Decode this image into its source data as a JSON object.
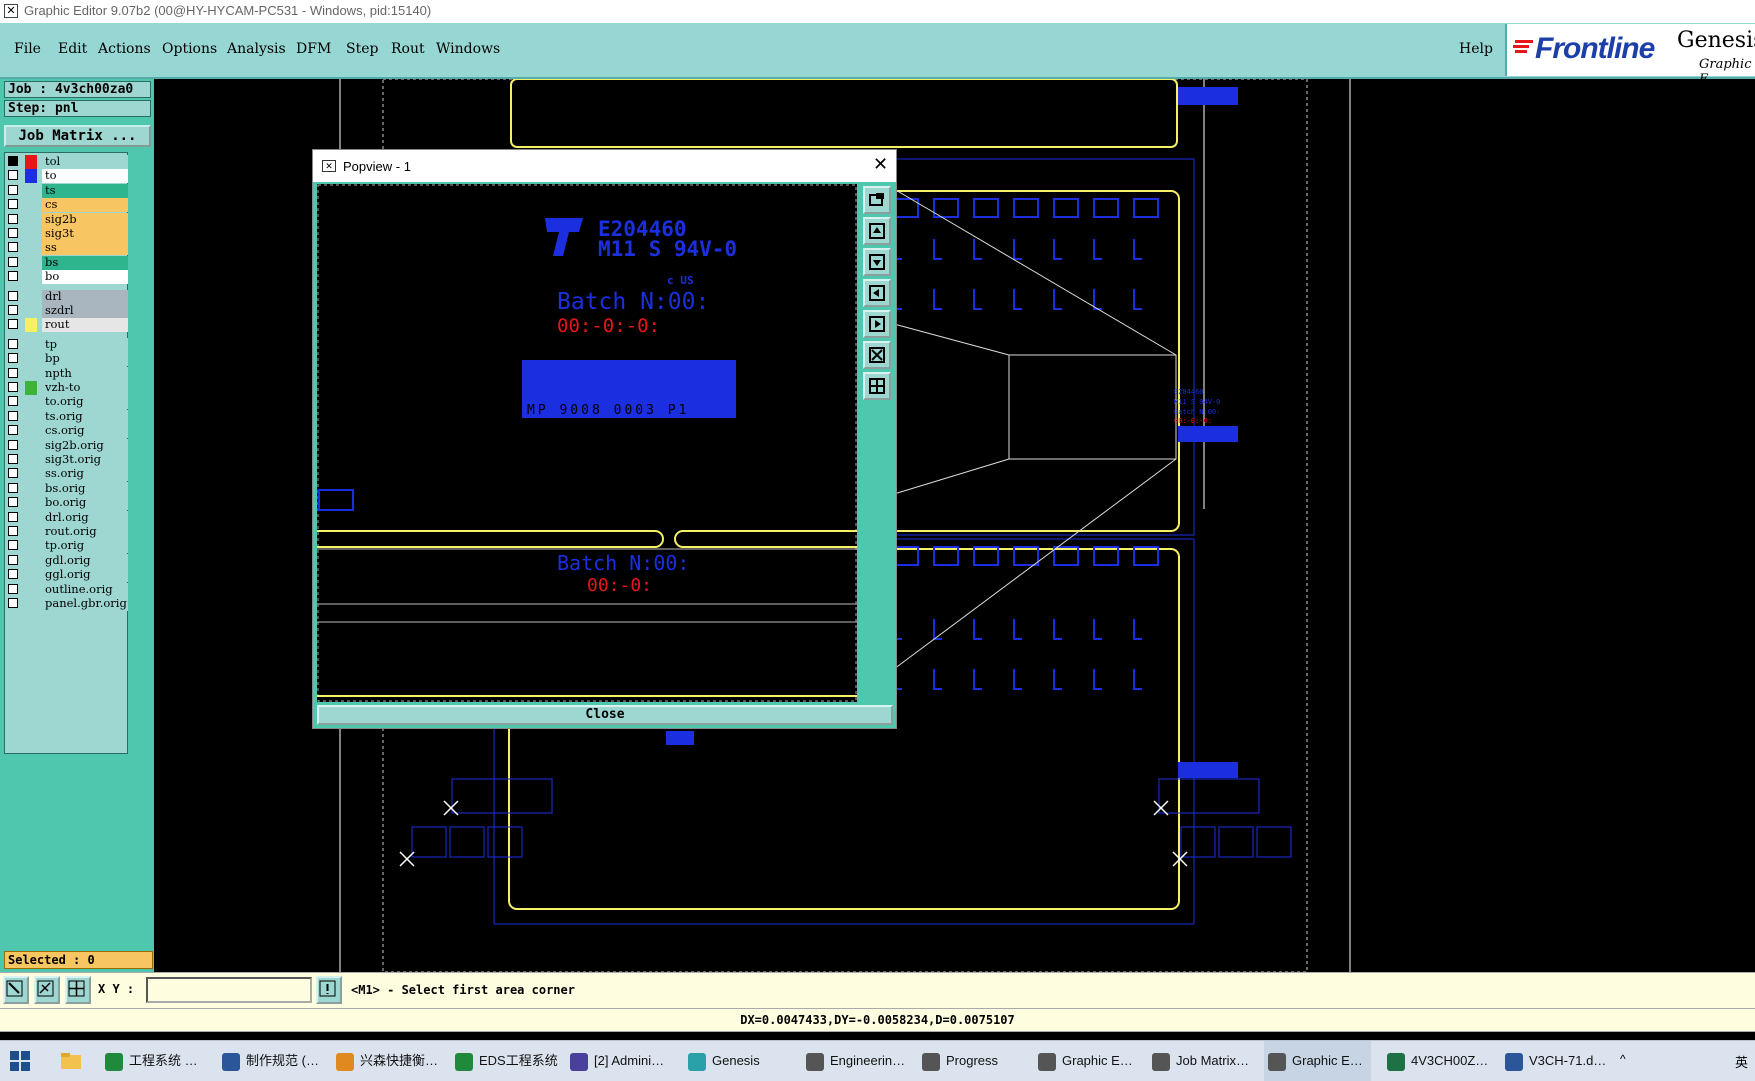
{
  "window": {
    "title": "Graphic Editor 9.07b2 (00@HY-HYCAM-PC531 - Windows, pid:15140)"
  },
  "menu": {
    "items": [
      "File",
      "Edit",
      "Actions",
      "Options",
      "Analysis",
      "DFM",
      "Step",
      "Rout",
      "Windows"
    ],
    "help": "Help"
  },
  "brand": {
    "logo": "Frontline",
    "product": "Genesis",
    "sub": "Graphic E"
  },
  "job": {
    "job_label": "Job : 4v3ch00za0",
    "step_label": "Step: pnl",
    "matrix_button": "Job Matrix ..."
  },
  "layers": [
    {
      "name": "tol",
      "color": "#9ed6d1",
      "swatch": "#e8151b",
      "sel": true
    },
    {
      "name": "to",
      "color": "#ffffff",
      "swatch": "#1b2fe0"
    },
    {
      "name": "ts",
      "color": "#2fb58e",
      "swatch": ""
    },
    {
      "name": "cs",
      "color": "#f7c561",
      "swatch": ""
    },
    {
      "name": "sig2b",
      "color": "#f7c561",
      "swatch": ""
    },
    {
      "name": "sig3t",
      "color": "#f7c561",
      "swatch": ""
    },
    {
      "name": "ss",
      "color": "#f7c561",
      "swatch": ""
    },
    {
      "name": "bs",
      "color": "#2fb58e",
      "swatch": ""
    },
    {
      "name": "bo",
      "color": "#ffffff",
      "swatch": ""
    },
    {
      "name": "drl",
      "color": "#a9b6c0",
      "swatch": "",
      "gap": true
    },
    {
      "name": "szdrl",
      "color": "#a9b6c0",
      "swatch": ""
    },
    {
      "name": "rout",
      "color": "#e6e6e6",
      "swatch": "#f5f066"
    },
    {
      "name": "tp",
      "color": "#9ed6d1",
      "swatch": "",
      "gap": true
    },
    {
      "name": "bp",
      "color": "#9ed6d1",
      "swatch": ""
    },
    {
      "name": "npth",
      "color": "#9ed6d1",
      "swatch": ""
    },
    {
      "name": "vzh-to",
      "color": "#9ed6d1",
      "swatch": "#3db33a"
    },
    {
      "name": "to.orig",
      "color": "#9ed6d1",
      "swatch": ""
    },
    {
      "name": "ts.orig",
      "color": "#9ed6d1",
      "swatch": ""
    },
    {
      "name": "cs.orig",
      "color": "#9ed6d1",
      "swatch": ""
    },
    {
      "name": "sig2b.orig",
      "color": "#9ed6d1",
      "swatch": ""
    },
    {
      "name": "sig3t.orig",
      "color": "#9ed6d1",
      "swatch": ""
    },
    {
      "name": "ss.orig",
      "color": "#9ed6d1",
      "swatch": ""
    },
    {
      "name": "bs.orig",
      "color": "#9ed6d1",
      "swatch": ""
    },
    {
      "name": "bo.orig",
      "color": "#9ed6d1",
      "swatch": ""
    },
    {
      "name": "drl.orig",
      "color": "#9ed6d1",
      "swatch": ""
    },
    {
      "name": "rout.orig",
      "color": "#9ed6d1",
      "swatch": ""
    },
    {
      "name": "tp.orig",
      "color": "#9ed6d1",
      "swatch": ""
    },
    {
      "name": "gdl.orig",
      "color": "#9ed6d1",
      "swatch": ""
    },
    {
      "name": "ggl.orig",
      "color": "#9ed6d1",
      "swatch": ""
    },
    {
      "name": "outline.orig",
      "color": "#9ed6d1",
      "swatch": ""
    },
    {
      "name": "panel.gbr.orig",
      "color": "#9ed6d1",
      "swatch": ""
    }
  ],
  "selected_label": "Selected : 0",
  "popview": {
    "title": "Popview - 1",
    "close_label": "Close",
    "ul_code": "E204460",
    "rating": "M11 S 94V-0",
    "batch1": "Batch N:00:",
    "batch2": "Batch N:00:",
    "date_code_1": "00:-0:-0:",
    "date_code_2": "00:-0:",
    "marking": "MP 9008 0003 P1",
    "reg_mark": "c US"
  },
  "board": {
    "ul_code": "E204460",
    "rating": "M11 S 94V-0",
    "batch": "Batch N:00:",
    "date": "00:-0:-0:"
  },
  "bottom": {
    "xy_label": "X Y :",
    "xy_value": "",
    "prompt": "<M1> - Select first area corner"
  },
  "status": {
    "measure": "DX=0.0047433,DY=-0.0058234,D=0.0075107"
  },
  "taskbar": {
    "items": [
      {
        "label": "工程系统 …",
        "icon": "#1f8a3b"
      },
      {
        "label": "制作规范 (…",
        "icon": "#2b579a"
      },
      {
        "label": "兴森快捷衡…",
        "icon": "#e0891e"
      },
      {
        "label": "EDS工程系统",
        "icon": "#1f8a3b"
      },
      {
        "label": "[2] Admini…",
        "icon": "#4a3f9c"
      },
      {
        "label": "Genesis",
        "icon": "#2aa0a8"
      },
      {
        "label": "Engineerin…",
        "icon": "#555555"
      },
      {
        "label": "Progress",
        "icon": "#555555"
      },
      {
        "label": "Graphic E…",
        "icon": "#555555"
      },
      {
        "label": "Job Matrix…",
        "icon": "#555555"
      },
      {
        "label": "Graphic E…",
        "icon": "#555555",
        "active": true
      },
      {
        "label": "4V3CH00Z…",
        "icon": "#1e7145"
      },
      {
        "label": "V3CH-71.d…",
        "icon": "#2b579a"
      }
    ],
    "tray_lang": "英"
  },
  "colors": {
    "accent": "#97d7d3",
    "panel": "#4fc7ae",
    "layer_blue": "#1b2fe0",
    "rout_yellow": "#f5f066",
    "date_red": "#e8151b"
  }
}
